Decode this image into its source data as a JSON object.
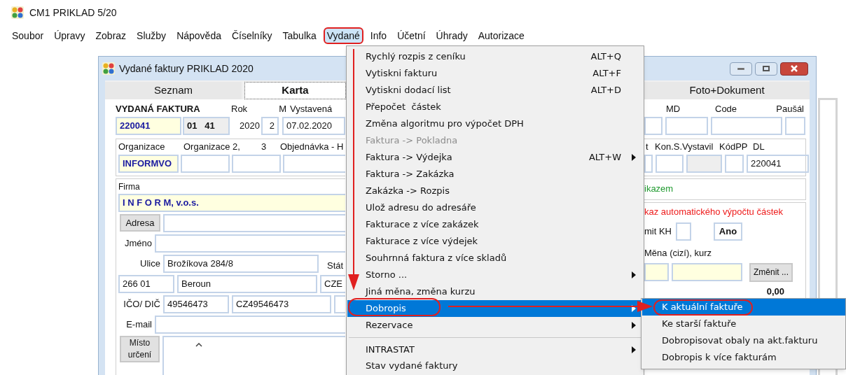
{
  "app": {
    "title": "CM1 PRIKLAD 5/20"
  },
  "menubar": [
    {
      "label": "Soubor",
      "selected": false
    },
    {
      "label": "Úpravy",
      "selected": false
    },
    {
      "label": "Zobraz",
      "selected": false
    },
    {
      "label": "Služby",
      "selected": false
    },
    {
      "label": "Nápověda",
      "selected": false
    },
    {
      "label": "Číselníky",
      "selected": false
    },
    {
      "label": "Tabulka",
      "selected": false
    },
    {
      "label": "Vydané",
      "selected": true
    },
    {
      "label": "Info",
      "selected": false
    },
    {
      "label": "Účetní",
      "selected": false
    },
    {
      "label": "Úhrady",
      "selected": false
    },
    {
      "label": "Autorizace",
      "selected": false
    }
  ],
  "window": {
    "title": "Vydané faktury PRIKLAD  2020",
    "tabs": [
      {
        "label": "Seznam",
        "selected": false
      },
      {
        "label": "Karta",
        "selected": true
      },
      {
        "label": "Foto+Dokument",
        "selected": false
      }
    ]
  },
  "invoice": {
    "heading": "VYDANÁ FAKTURA",
    "rok_label": "Rok",
    "m_label": "M",
    "vystavena_label": "Vystavená",
    "number": "220041",
    "series": "01   41",
    "year": "2020",
    "month": "2",
    "date": "07.02.2020"
  },
  "organizace": {
    "labels": [
      "Organizace",
      "Organizace 2,",
      "3",
      "Objednávka - H"
    ],
    "code": "INFORMVO"
  },
  "firma": {
    "label": "Firma",
    "name": "I N F O R M, v.o.s.",
    "address_button": "Adresa",
    "jmeno_label": "Jméno",
    "ulice_label": "Ulice",
    "ulice": "Brožíkova 284/8",
    "stat_label": "Stát",
    "psc": "266 01",
    "mesto": "Beroun",
    "stat": "CZE",
    "ico_label": "IČO/ DIČ",
    "ico": "49546473",
    "dic": "CZ49546473",
    "email_label": "E-mail",
    "misto_button": "Místo určení"
  },
  "right": {
    "labels": [
      "MD",
      "Code",
      "Paušál"
    ],
    "group_labels": [
      "t",
      "Kon.S.Vystavil",
      "KódPP",
      "DL"
    ],
    "dl": "220041",
    "note_green": "ikazem",
    "note_red": "kaz automatického výpočtu částek",
    "kh_label": "mit KH",
    "ano": "Ano",
    "mena_label": "Měna (cizí), kurz",
    "change_button": "Změnit ...",
    "total": "0,00"
  },
  "menu": [
    {
      "label": "Rychlý rozpis z ceníku",
      "shortcut": "ALT+Q",
      "submenu": false,
      "disabled": false,
      "selected": false,
      "separator_before": false
    },
    {
      "label": "Vytiskni fakturu",
      "shortcut": "ALT+F",
      "submenu": false,
      "disabled": false,
      "selected": false,
      "separator_before": false
    },
    {
      "label": "Vytiskni dodací list",
      "shortcut": "ALT+D",
      "submenu": false,
      "disabled": false,
      "selected": false,
      "separator_before": false
    },
    {
      "label": "Přepočet  částek",
      "submenu": false,
      "disabled": false,
      "selected": false,
      "separator_before": false
    },
    {
      "label": "Změna algoritmu pro výpočet DPH",
      "submenu": false,
      "disabled": false,
      "selected": false,
      "separator_before": false
    },
    {
      "label": "Faktura -> Pokladna",
      "submenu": false,
      "disabled": true,
      "selected": false,
      "separator_before": false
    },
    {
      "label": "Faktura -> Výdejka",
      "shortcut": "ALT+W",
      "submenu": true,
      "disabled": false,
      "selected": false,
      "separator_before": false
    },
    {
      "label": "Faktura -> Zakázka",
      "submenu": false,
      "disabled": false,
      "selected": false,
      "separator_before": false
    },
    {
      "label": "Zakázka -> Rozpis",
      "submenu": false,
      "disabled": false,
      "selected": false,
      "separator_before": false
    },
    {
      "label": "Ulož adresu do adresáře",
      "submenu": false,
      "disabled": false,
      "selected": false,
      "separator_before": false
    },
    {
      "label": "Fakturace z více zakázek",
      "submenu": false,
      "disabled": false,
      "selected": false,
      "separator_before": false
    },
    {
      "label": "Fakturace z více výdejek",
      "submenu": false,
      "disabled": false,
      "selected": false,
      "separator_before": false
    },
    {
      "label": "Souhrnná faktura z více skladů",
      "submenu": false,
      "disabled": false,
      "selected": false,
      "separator_before": false
    },
    {
      "label": "Storno ...",
      "submenu": true,
      "disabled": false,
      "selected": false,
      "separator_before": false
    },
    {
      "label": "Jiná měna, změna kurzu",
      "submenu": false,
      "disabled": false,
      "selected": false,
      "separator_before": false
    },
    {
      "label": "Dobropis",
      "submenu": true,
      "disabled": false,
      "selected": true,
      "separator_before": false
    },
    {
      "label": "Rezervace",
      "submenu": true,
      "disabled": false,
      "selected": false,
      "separator_before": false
    },
    {
      "label": "INTRASTAT",
      "submenu": true,
      "disabled": false,
      "selected": false,
      "separator_before": true
    },
    {
      "label": "Stav vydané faktury",
      "submenu": false,
      "disabled": false,
      "selected": false,
      "separator_before": false
    }
  ],
  "submenu": [
    {
      "label": "K aktuální faktuře",
      "selected": true
    },
    {
      "label": "Ke starší faktuře",
      "selected": false
    },
    {
      "label": "Dobropisovat obaly na akt.fakturu",
      "selected": false
    },
    {
      "label": "Dobropis k více fakturám",
      "selected": false
    }
  ]
}
